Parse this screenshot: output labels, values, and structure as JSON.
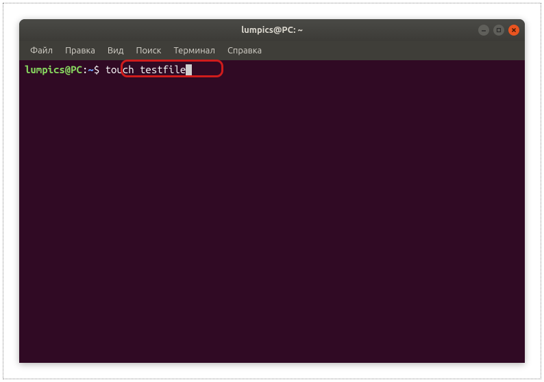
{
  "window": {
    "title": "lumpics@PC: ~"
  },
  "menubar": {
    "items": [
      {
        "label": "Файл"
      },
      {
        "label": "Правка"
      },
      {
        "label": "Вид"
      },
      {
        "label": "Поиск"
      },
      {
        "label": "Терминал"
      },
      {
        "label": "Справка"
      }
    ]
  },
  "terminal": {
    "prompt_user": "lumpics@PC",
    "prompt_colon": ":",
    "prompt_path": "~",
    "prompt_dollar": "$",
    "command": " touch testfile"
  }
}
